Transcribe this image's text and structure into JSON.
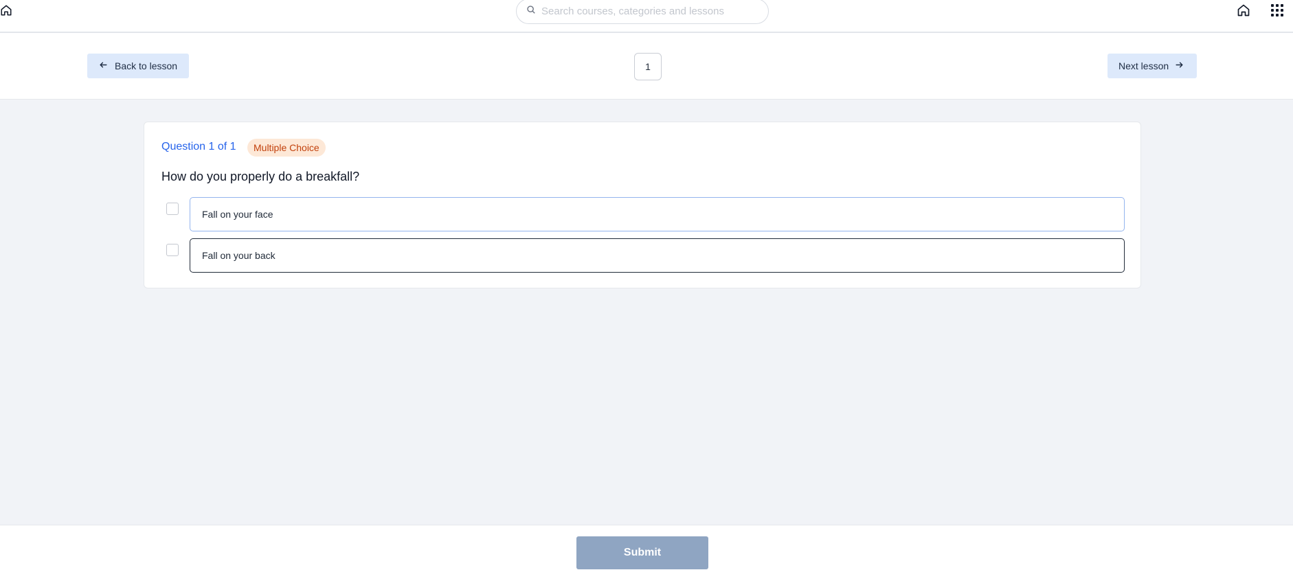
{
  "header": {
    "search": {
      "placeholder": "Search courses, categories and lessons",
      "value": ""
    }
  },
  "nav": {
    "back_label": "Back to lesson",
    "next_label": "Next lesson",
    "page_number": "1"
  },
  "question": {
    "counter": "Question 1 of 1",
    "type": "Multiple Choice",
    "text": "How do you properly do a breakfall?",
    "options": [
      {
        "label": "Fall on your face",
        "checked": false
      },
      {
        "label": "Fall on your back",
        "checked": false
      }
    ]
  },
  "footer": {
    "submit_label": "Submit"
  },
  "icons": [
    "home-icon",
    "search-icon",
    "apps-grid-icon",
    "arrow-left-icon",
    "arrow-right-icon"
  ],
  "colors": {
    "accent": "#2563eb",
    "badge_text": "#c2410c",
    "badge_bg": "#fde8d7",
    "submit_bg": "#8fa5c2",
    "nav_button_bg": "#dde9fb"
  }
}
